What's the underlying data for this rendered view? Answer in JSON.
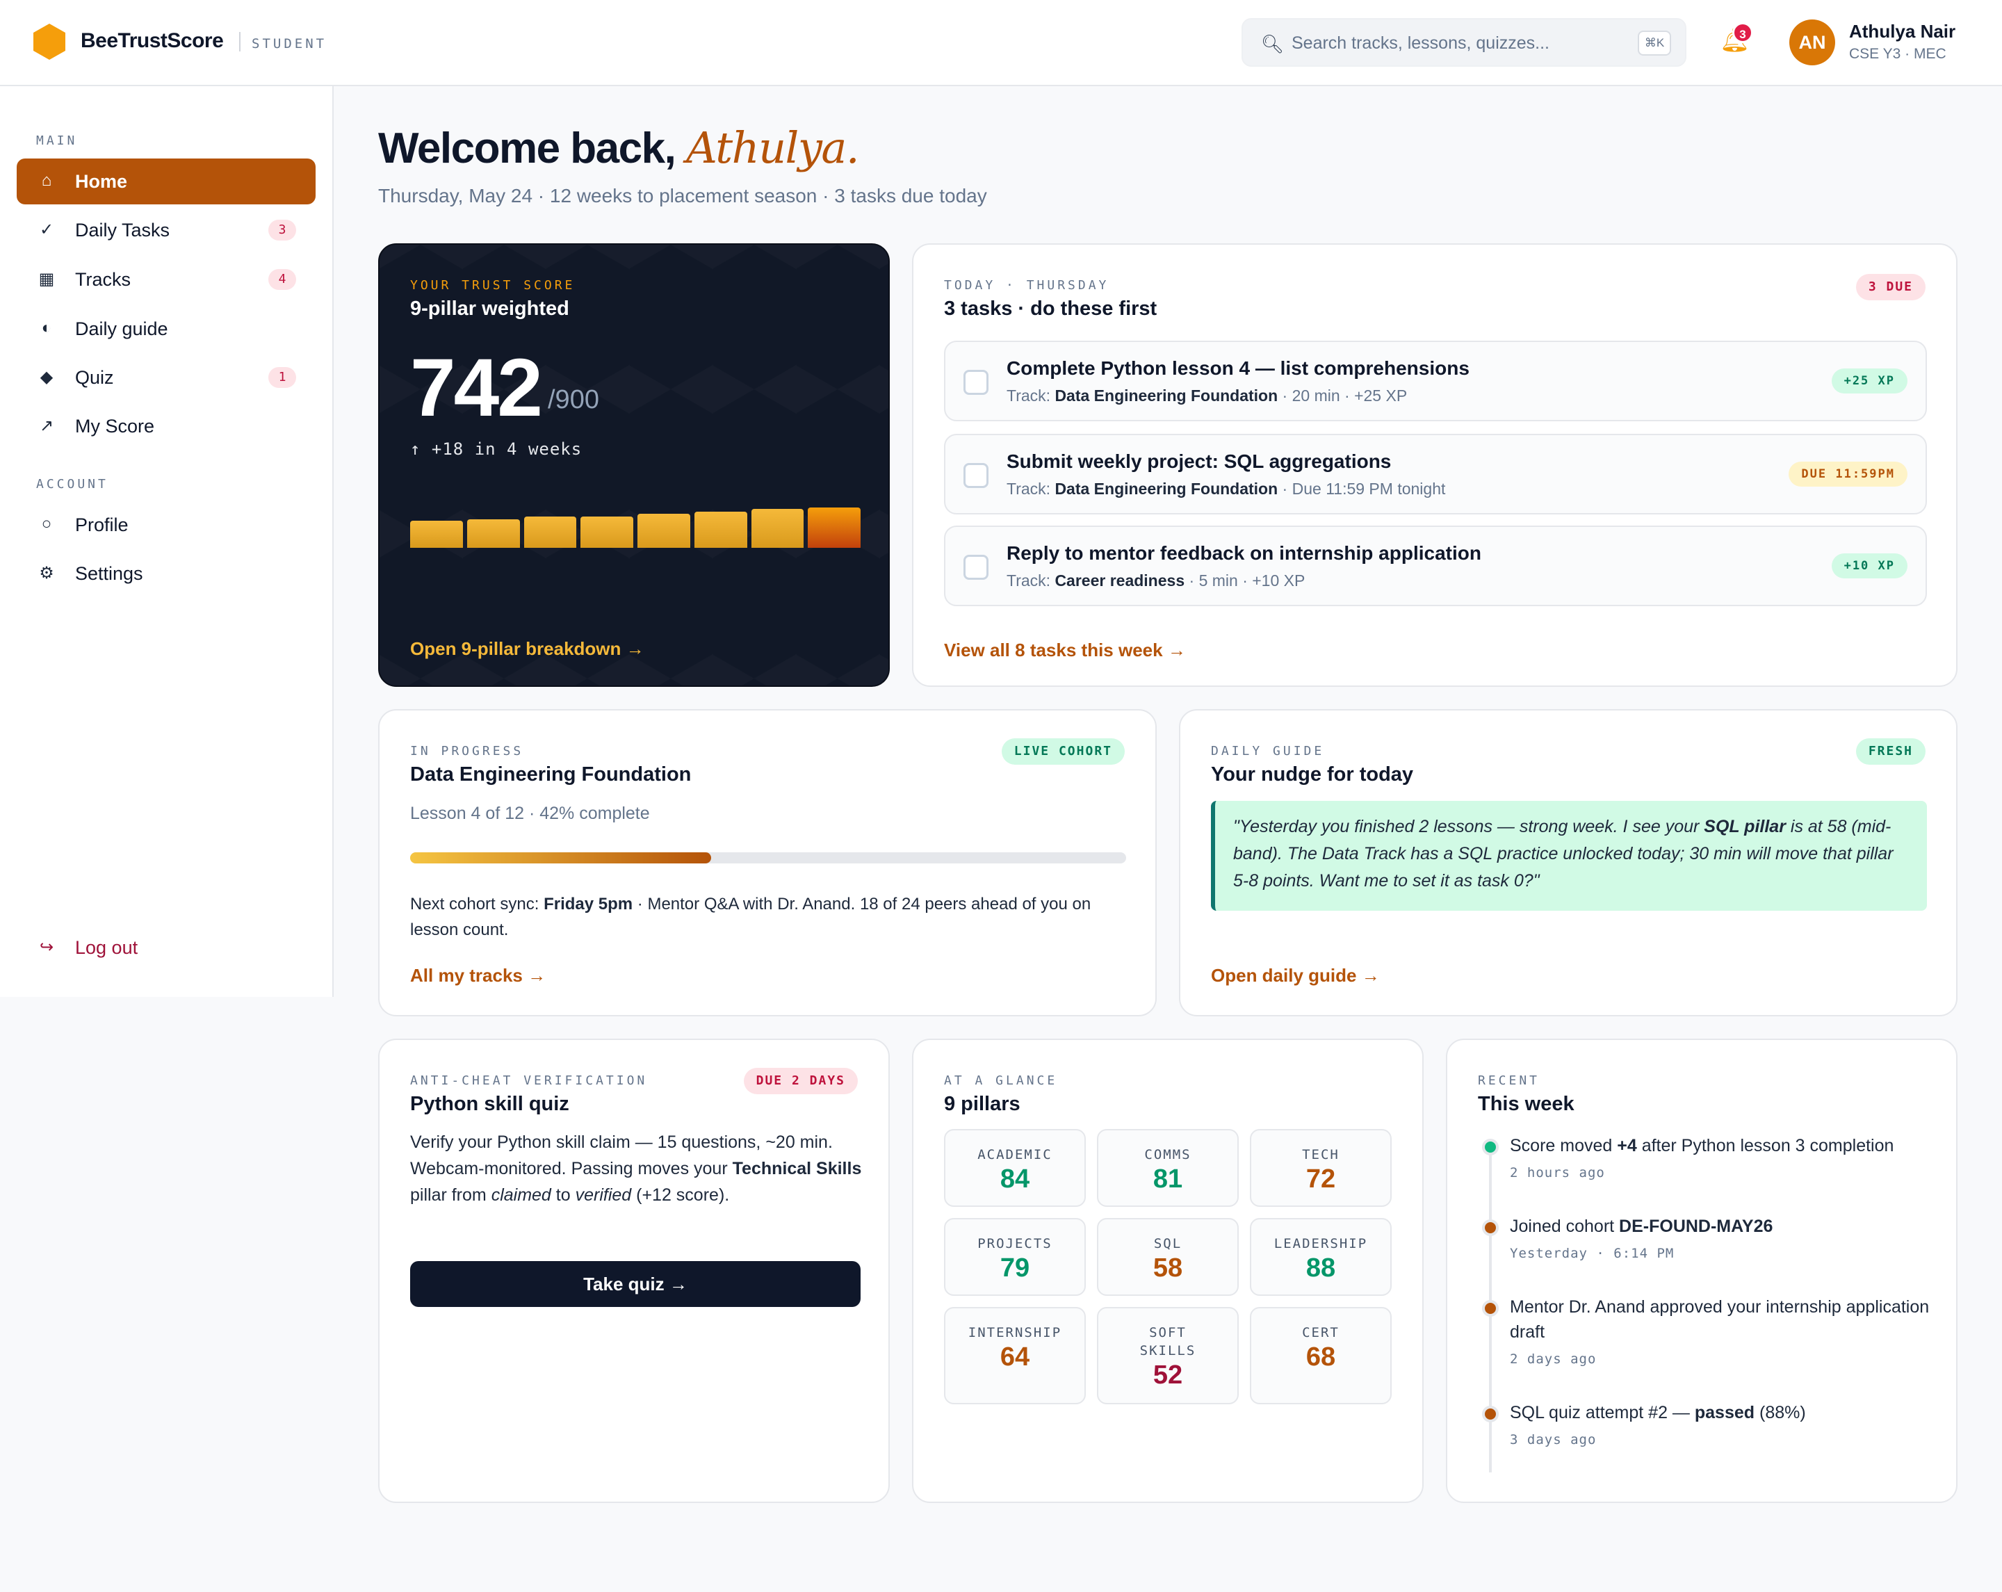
{
  "app": {
    "brand": "BeeTrustScore",
    "role": "STUDENT"
  },
  "header": {
    "search_placeholder": "Search tracks, lessons, quizzes...",
    "search_shortcut": "⌘K",
    "notifications_count": "3",
    "user": {
      "initials": "AN",
      "name": "Athulya Nair",
      "meta": "CSE Y3 · MEC"
    }
  },
  "sidebar": {
    "main_label": "MAIN",
    "account_label": "ACCOUNT",
    "items": [
      {
        "icon": "home-icon",
        "glyph": "⌂",
        "label": "Home",
        "badge": ""
      },
      {
        "icon": "check-icon",
        "glyph": "✓",
        "label": "Daily Tasks",
        "badge": "3"
      },
      {
        "icon": "grid-icon",
        "glyph": "▦",
        "label": "Tracks",
        "badge": "4"
      },
      {
        "icon": "half-circle-icon",
        "glyph": "◐",
        "label": "Daily guide",
        "badge": ""
      },
      {
        "icon": "diamond-icon",
        "glyph": "◆",
        "label": "Quiz",
        "badge": "1"
      },
      {
        "icon": "trend-icon",
        "glyph": "↗",
        "label": "My Score",
        "badge": ""
      }
    ],
    "account": [
      {
        "icon": "user-icon",
        "glyph": "○",
        "label": "Profile"
      },
      {
        "icon": "gear-icon",
        "glyph": "⚙",
        "label": "Settings"
      }
    ],
    "logout": {
      "icon": "logout-icon",
      "glyph": "↪",
      "label": "Log out"
    }
  },
  "welcome": {
    "prefix": "Welcome back, ",
    "name": "Athulya.",
    "subline": "Thursday, May 24 · 12 weeks to placement season · 3 tasks due today"
  },
  "trust_score": {
    "eyebrow": "YOUR TRUST SCORE",
    "title": "9-pillar weighted",
    "score": "742",
    "max": "/900",
    "delta": "↑ +18 in 4 weeks",
    "history_values": [
      724,
      726,
      730,
      730,
      734,
      736,
      740,
      742
    ],
    "history_floor": 714,
    "link": "Open 9-pillar breakdown →"
  },
  "tasks": {
    "eyebrow": "TODAY · THURSDAY",
    "title": "3 tasks · do these first",
    "due_pill": "3 DUE",
    "track_prefix": "Track: ",
    "items": [
      {
        "title": "Complete Python lesson 4 — list comprehensions",
        "track": "Data Engineering Foundation",
        "meta": " · 20 min · +25 XP",
        "pill": "+25 XP",
        "pill_kind": "green"
      },
      {
        "title": "Submit weekly project: SQL aggregations",
        "track": "Data Engineering Foundation",
        "meta": " · Due 11:59 PM tonight",
        "pill": "DUE 11:59PM",
        "pill_kind": "amber"
      },
      {
        "title": "Reply to mentor feedback on internship application",
        "track": "Career readiness",
        "meta": " · 5 min · +10 XP",
        "pill": "+10 XP",
        "pill_kind": "green"
      }
    ],
    "link": "View all 8 tasks this week →"
  },
  "in_progress": {
    "eyebrow": "IN PROGRESS",
    "title": "Data Engineering Foundation",
    "pill": "LIVE COHORT",
    "sub": "Lesson 4 of 12 · 42% complete",
    "progress": 0.42,
    "note_a": "Next cohort sync: ",
    "note_bold": "Friday 5pm",
    "note_b": " · Mentor Q&A with Dr. Anand. 18 of 24 peers ahead of you on lesson count.",
    "link": "All my tracks →"
  },
  "daily_guide": {
    "eyebrow": "DAILY GUIDE",
    "title": "Your nudge for today",
    "pill": "FRESH",
    "quote_a": "\"Yesterday you finished 2 lessons — strong week. I see your ",
    "quote_bold": "SQL pillar",
    "quote_b": " is at 58 (mid-band). The Data Track has a SQL practice unlocked today; 30 min will move that pillar 5-8 points. Want me to set it as task 0?\"",
    "link": "Open daily guide →"
  },
  "quiz": {
    "eyebrow": "ANTI-CHEAT VERIFICATION",
    "title": "Python skill quiz",
    "pill": "DUE 2 DAYS",
    "body_a": "Verify your Python skill claim — 15 questions, ~20 min. Webcam-monitored. Passing moves your ",
    "body_bold": "Technical Skills",
    "body_b": " pillar from ",
    "body_i1": "claimed",
    "body_c": " to ",
    "body_i2": "verified",
    "body_d": " (+12 score).",
    "button": "Take quiz →"
  },
  "pillars": {
    "eyebrow": "AT A GLANCE",
    "title": "9 pillars",
    "items": [
      {
        "name": "ACADEMIC",
        "value": "84",
        "color": "#059669"
      },
      {
        "name": "COMMS",
        "value": "81",
        "color": "#059669"
      },
      {
        "name": "TECH",
        "value": "72",
        "color": "#b45309"
      },
      {
        "name": "PROJECTS",
        "value": "79",
        "color": "#059669"
      },
      {
        "name": "SQL",
        "value": "58",
        "color": "#b45309"
      },
      {
        "name": "LEADERSHIP",
        "value": "88",
        "color": "#059669"
      },
      {
        "name": "INTERNSHIP",
        "value": "64",
        "color": "#b45309"
      },
      {
        "name": "SOFT SKILLS",
        "value": "52",
        "color": "#9f1239"
      },
      {
        "name": "CERT",
        "value": "68",
        "color": "#b45309"
      }
    ]
  },
  "recent": {
    "eyebrow": "RECENT",
    "title": "This week",
    "events": [
      {
        "a": "Score moved ",
        "bold": "+4",
        "b": " after Python lesson 3 completion",
        "time": "2 hours ago",
        "dot": "#10b981"
      },
      {
        "a": "Joined cohort ",
        "bold": "DE-FOUND-MAY26",
        "b": "",
        "time": "Yesterday · 6:14 PM",
        "dot": "#b45309"
      },
      {
        "a": "Mentor Dr. Anand approved your internship application draft",
        "bold": "",
        "b": "",
        "time": "2 days ago",
        "dot": "#b45309"
      },
      {
        "a": "SQL quiz attempt #2 — ",
        "bold": "passed",
        "b": " (88%)",
        "time": "3 days ago",
        "dot": "#b45309"
      }
    ]
  },
  "colors": {
    "accent": "#b45309",
    "brand": "#f59e0b",
    "dark": "#111827"
  }
}
